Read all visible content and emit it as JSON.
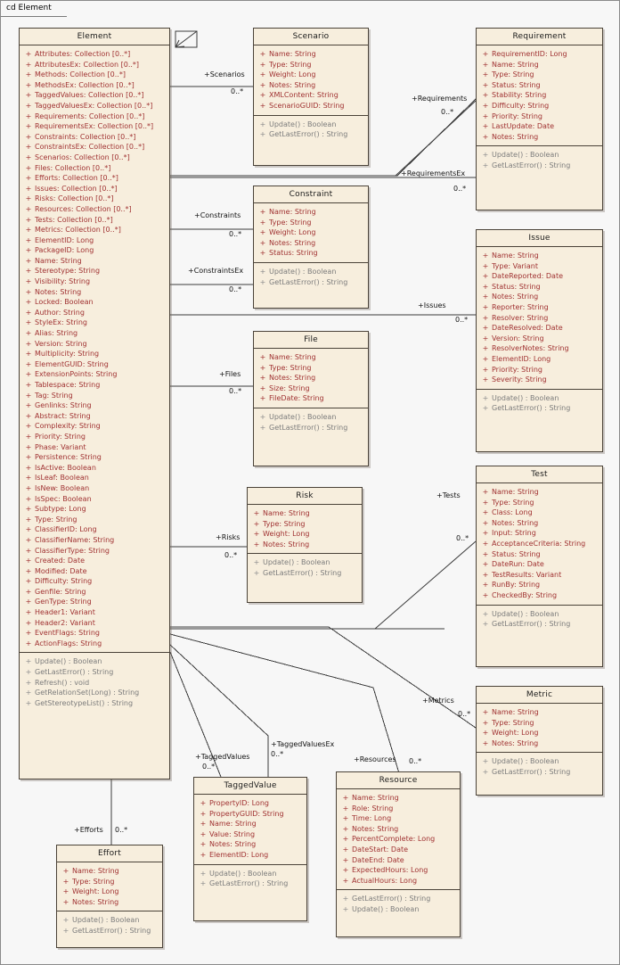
{
  "diagram": {
    "tab_label": "cd Element",
    "colors": {
      "class_fill": "#f7eedd",
      "class_border": "#4a4238",
      "attribute_text": "#a03232",
      "operation_text": "#7c7c7c",
      "canvas": "#f7f7f7"
    }
  },
  "classes": {
    "element": {
      "name": "Element",
      "attributes": [
        "Attributes:  Collection [0..*]",
        "AttributesEx:  Collection [0..*]",
        "Methods:  Collection [0..*]",
        "MethodsEx:  Collection [0..*]",
        "TaggedValues:  Collection [0..*]",
        "TaggedValuesEx:  Collection [0..*]",
        "Requirements:  Collection [0..*]",
        "RequirementsEx:  Collection [0..*]",
        "Constraints:  Collection [0..*]",
        "ConstraintsEx:  Collection [0..*]",
        "Scenarios:  Collection [0..*]",
        "Files:  Collection [0..*]",
        "Efforts:  Collection [0..*]",
        "Issues:  Collection [0..*]",
        "Risks:  Collection [0..*]",
        "Resources:  Collection [0..*]",
        "Tests:  Collection [0..*]",
        "Metrics:  Collection [0..*]",
        "ElementID:  Long",
        "PackageID:  Long",
        "Name:  String",
        "Stereotype:  String",
        "Visibility:  String",
        "Notes:  String",
        "Locked:  Boolean",
        "Author:  String",
        "StyleEx:  String",
        "Alias:  String",
        "Version:  String",
        "Multiplicity:  String",
        "ElementGUID:  String",
        "ExtensionPoints:  String",
        "Tablespace:  String",
        "Tag:  String",
        "Genlinks:  String",
        "Abstract:  String",
        "Complexity:  String",
        "Priority:  String",
        "Phase:  Variant",
        "Persistence:  String",
        "IsActive:  Boolean",
        "IsLeaf:  Boolean",
        "IsNew:  Boolean",
        "IsSpec:  Boolean",
        "Subtype:  Long",
        "Type:  String",
        "ClassifierID:  Long",
        "ClassifierName:  String",
        "ClassifierType:  String",
        "Created:  Date",
        "Modified:  Date",
        "Difficulty:  String",
        "Genfile:  String",
        "GenType:  String",
        "Header1:  Variant",
        "Header2:  Variant",
        "EventFlags:  String",
        "ActionFlags:  String"
      ],
      "operations": [
        "Update() : Boolean",
        "GetLastError() : String",
        "Refresh() : void",
        "GetRelationSet(Long) : String",
        "GetStereotypeList() : String"
      ]
    },
    "scenario": {
      "name": "Scenario",
      "attributes": [
        "Name:  String",
        "Type:  String",
        "Weight:  Long",
        "Notes:  String",
        "XMLContent:  String",
        "ScenarioGUID:  String"
      ],
      "operations": [
        "Update() : Boolean",
        "GetLastError() : String"
      ]
    },
    "requirement": {
      "name": "Requirement",
      "attributes": [
        "RequirementID:  Long",
        "Name:  String",
        "Type:  String",
        "Status:  String",
        "Stability:  String",
        "Difficulty:  String",
        "Priority:  String",
        "LastUpdate:  Date",
        "Notes:  String"
      ],
      "operations": [
        "Update() : Boolean",
        "GetLastError() : String"
      ]
    },
    "constraint": {
      "name": "Constraint",
      "attributes": [
        "Name:  String",
        "Type:  String",
        "Weight:  Long",
        "Notes:  String",
        "Status:  String"
      ],
      "operations": [
        "Update() : Boolean",
        "GetLastError() : String"
      ]
    },
    "issue": {
      "name": "Issue",
      "attributes": [
        "Name:  String",
        "Type:  Variant",
        "DateReported:  Date",
        "Status:  String",
        "Notes:  String",
        "Reporter:  String",
        "Resolver:  String",
        "DateResolved:  Date",
        "Version:  String",
        "ResolverNotes:  String",
        "ElementID:  Long",
        "Priority:  String",
        "Severity:  String"
      ],
      "operations": [
        "Update() : Boolean",
        "GetLastError() : String"
      ]
    },
    "file": {
      "name": "File",
      "attributes": [
        "Name:  String",
        "Type:  String",
        "Notes:  String",
        "Size:  String",
        "FileDate:  String"
      ],
      "operations": [
        "Update() : Boolean",
        "GetLastError() : String"
      ]
    },
    "risk": {
      "name": "Risk",
      "attributes": [
        "Name:  String",
        "Type:  String",
        "Weight:  Long",
        "Notes:  String"
      ],
      "operations": [
        "Update() : Boolean",
        "GetLastError() : String"
      ]
    },
    "test": {
      "name": "Test",
      "attributes": [
        "Name:  String",
        "Type:  String",
        "Class:  Long",
        "Notes:  String",
        "Input:  String",
        "AcceptanceCriteria:  String",
        "Status:  String",
        "DateRun:  Date",
        "TestResults:  Variant",
        "RunBy:  String",
        "CheckedBy:  String"
      ],
      "operations": [
        "Update() : Boolean",
        "GetLastError() : String"
      ]
    },
    "metric": {
      "name": "Metric",
      "attributes": [
        "Name:  String",
        "Type:  String",
        "Weight:  Long",
        "Notes:  String"
      ],
      "operations": [
        "Update() : Boolean",
        "GetLastError() : String"
      ]
    },
    "taggedvalue": {
      "name": "TaggedValue",
      "attributes": [
        "PropertyID:  Long",
        "PropertyGUID:  String",
        "Name:  String",
        "Value:  String",
        "Notes:  String",
        "ElementID:  Long"
      ],
      "operations": [
        "Update() : Boolean",
        "GetLastError() : String"
      ]
    },
    "resource": {
      "name": "Resource",
      "attributes": [
        "Name:  String",
        "Role:  String",
        "Time:  Long",
        "Notes:  String",
        "PercentComplete:  Long",
        "DateStart:  Date",
        "DateEnd:  Date",
        "ExpectedHours:  Long",
        "ActualHours:  Long"
      ],
      "operations": [
        "GetLastError() : String",
        "Update() : Boolean"
      ]
    },
    "effort": {
      "name": "Effort",
      "attributes": [
        "Name:  String",
        "Type:  String",
        "Weight:  Long",
        "Notes:  String"
      ],
      "operations": [
        "Update() : Boolean",
        "GetLastError() : String"
      ]
    }
  },
  "associations": {
    "scenarios": {
      "role": "+Scenarios",
      "mult": "0..*"
    },
    "requirements": {
      "role": "+Requirements",
      "mult": "0..*"
    },
    "requirementsex": {
      "role": "+RequirementsEx",
      "mult": "0..*"
    },
    "constraints": {
      "role": "+Constraints",
      "mult": "0..*"
    },
    "constraintsex": {
      "role": "+ConstraintsEx",
      "mult": "0..*"
    },
    "issues": {
      "role": "+Issues",
      "mult": "0..*"
    },
    "files": {
      "role": "+Files",
      "mult": "0..*"
    },
    "risks": {
      "role": "+Risks",
      "mult": "0..*"
    },
    "tests": {
      "role": "+Tests",
      "mult": "0..*"
    },
    "metrics": {
      "role": "+Metrics",
      "mult": "0..*"
    },
    "taggedvalues": {
      "role": "+TaggedValues",
      "mult": "0..*"
    },
    "taggedvaluesex": {
      "role": "+TaggedValuesEx",
      "mult": "0..*"
    },
    "resources": {
      "role": "+Resources",
      "mult": "0..*"
    },
    "efforts": {
      "role": "+Efforts",
      "mult": "0..*"
    }
  }
}
